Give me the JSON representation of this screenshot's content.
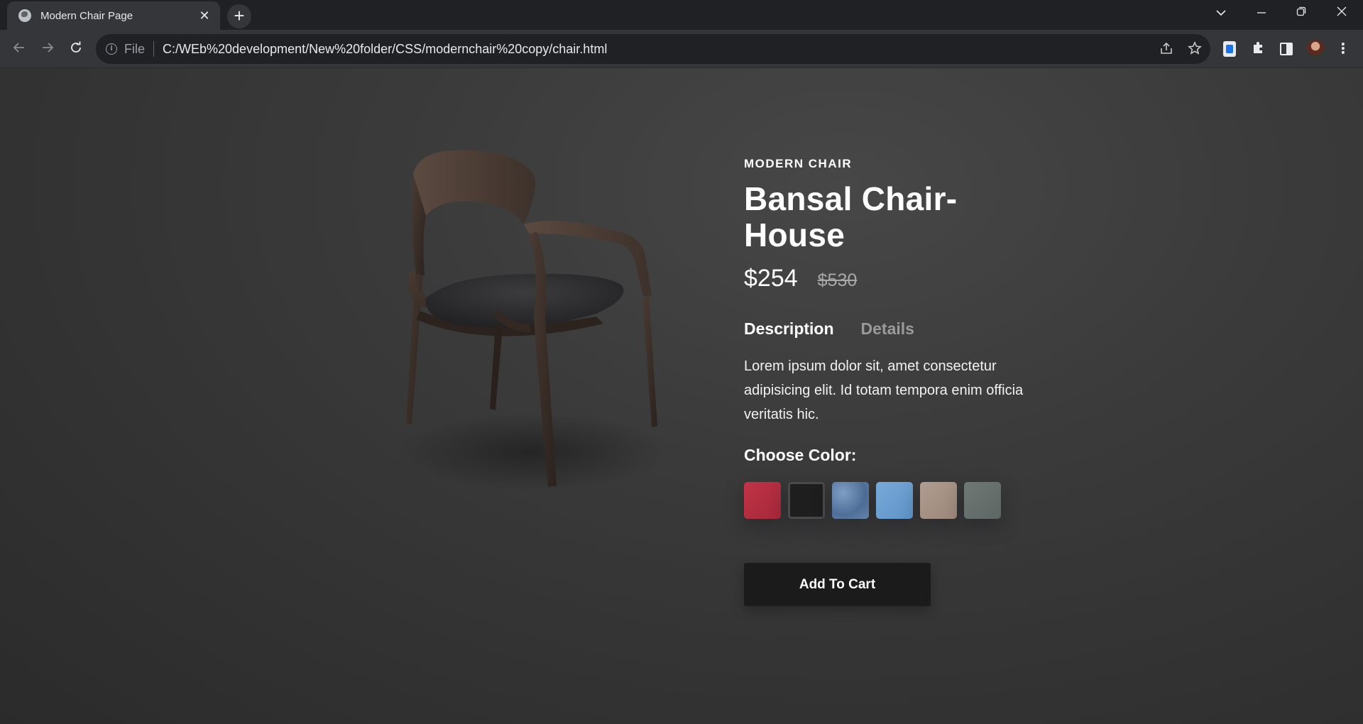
{
  "browser": {
    "tab_title": "Modern Chair Page",
    "tab_close": "✕",
    "new_tab": "+",
    "address_scheme_label": "File",
    "address_url": "C:/WEb%20development/New%20folder/CSS/modernchair%20copy/chair.html",
    "window_controls": {
      "dropdown": "⌄",
      "minimize": "—",
      "restore": "❐",
      "close": "✕"
    }
  },
  "product": {
    "category": "MODERN CHAIR",
    "title": "Bansal Chair-House",
    "price": "$254",
    "old_price": "$530",
    "tabs": [
      {
        "label": "Description",
        "active": true
      },
      {
        "label": "Details",
        "active": false
      }
    ],
    "description": "Lorem ipsum dolor sit, amet consectetur adipisicing elit. Id totam tempora enim officia veritatis hic.",
    "choose_color_label": "Choose Color:",
    "colors": [
      {
        "name": "red",
        "hex": "#b62c3f"
      },
      {
        "name": "black",
        "hex": "#1e1e1e"
      },
      {
        "name": "denim",
        "hex": "#5d7ea8"
      },
      {
        "name": "sky-blue",
        "hex": "#6e9fd0"
      },
      {
        "name": "beige",
        "hex": "#a89285"
      },
      {
        "name": "grey",
        "hex": "#66706d"
      }
    ],
    "selected_color": "black",
    "cart_button": "Add To Cart"
  },
  "icons": {
    "back": "arrow-left-icon",
    "forward": "arrow-right-icon",
    "reload": "reload-icon",
    "info": "info-icon",
    "share": "share-icon",
    "bookmark": "star-icon",
    "extension": "extension-icon",
    "puzzle": "puzzle-icon",
    "side_panel": "side-panel-icon",
    "menu": "kebab-menu-icon"
  }
}
